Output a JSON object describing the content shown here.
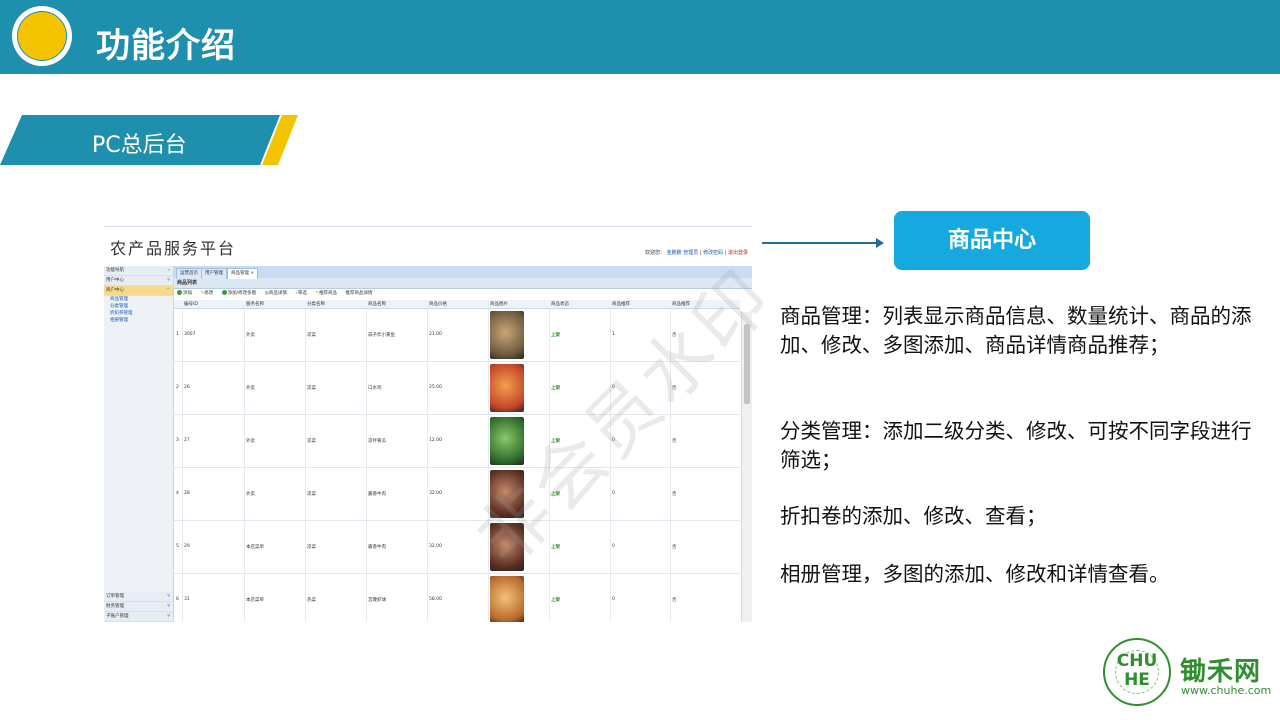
{
  "header": {
    "title": "功能介绍"
  },
  "banner": {
    "title": "PC总后台"
  },
  "screenshot": {
    "brand": "农产品服务平台",
    "toplinks": {
      "welcome": "欢迎您：",
      "user": "金鹏鹏 管理员",
      "sep1": "|",
      "change_pwd": "修改密码",
      "sep2": "|",
      "logout": "退出登录"
    },
    "sidebar": {
      "top": [
        {
          "label": "功能导航"
        },
        {
          "label": "用户中心"
        },
        {
          "label": "商户中心"
        }
      ],
      "sub_items": [
        "商品管理",
        "分类管理",
        "折扣券管理",
        "相册管理"
      ],
      "bottom": [
        "订单管理",
        "财务管理",
        "子账户管理"
      ]
    },
    "tabs": [
      "运营首页",
      "用户管理",
      "商品管理 ×"
    ],
    "panel_title": "商品列表",
    "toolbar": [
      "添加",
      "修改",
      "添加/修改多图",
      "商品详情",
      "筛选",
      "推荐商品",
      "推荐商品详情"
    ],
    "columns": [
      "编号ID",
      "服务名称",
      "分类名称",
      "商品名称",
      "商品价格",
      "商品图片",
      "商品状态",
      "商品推荐",
      "商品推荐"
    ],
    "rows": [
      {
        "idx": "1",
        "id": "3007",
        "service": "外卖",
        "category": "凉菜",
        "name": "蒜子炸小黄鱼",
        "price": "21.00",
        "status": "上架",
        "rec": "1",
        "rec2": "否"
      },
      {
        "idx": "2",
        "id": "26",
        "service": "外卖",
        "category": "凉菜",
        "name": "口水鸡",
        "price": "25.00",
        "status": "上架",
        "rec": "0",
        "rec2": "否"
      },
      {
        "idx": "3",
        "id": "27",
        "service": "外卖",
        "category": "凉菜",
        "name": "凉拌黄瓜",
        "price": "12.00",
        "status": "上架",
        "rec": "0",
        "rec2": "否"
      },
      {
        "idx": "4",
        "id": "28",
        "service": "外卖",
        "category": "凉菜",
        "name": "酱香牛肉",
        "price": "32.00",
        "status": "上架",
        "rec": "0",
        "rec2": "否"
      },
      {
        "idx": "5",
        "id": "29",
        "service": "本店菜单",
        "category": "凉菜",
        "name": "酱香牛肉",
        "price": "32.00",
        "status": "上架",
        "rec": "0",
        "rec2": "否"
      },
      {
        "idx": "6",
        "id": "31",
        "service": "本店菜单",
        "category": "热菜",
        "name": "宫爆虾球",
        "price": "58.00",
        "status": "上架",
        "rec": "0",
        "rec2": "否"
      }
    ]
  },
  "watermark": "非会员水印",
  "center": {
    "label": "商品中心"
  },
  "descriptions": [
    "商品管理：列表显示商品信息、数量统计、商品的添加、修改、多图添加、商品详情商品推荐；",
    "分类管理：添加二级分类、修改、可按不同字段进行筛选；",
    "折扣卷的添加、修改、查看；",
    "相册管理，多图的添加、修改和详情查看。"
  ],
  "footer": {
    "brand_mark": "CHU HE",
    "brand_name": "锄禾网",
    "url": "www.chuhe.com"
  },
  "colors": {
    "header": "#1f8fae",
    "accent_yellow": "#f5c400",
    "button": "#16a9e0",
    "brand_green": "#2f8f2f"
  }
}
